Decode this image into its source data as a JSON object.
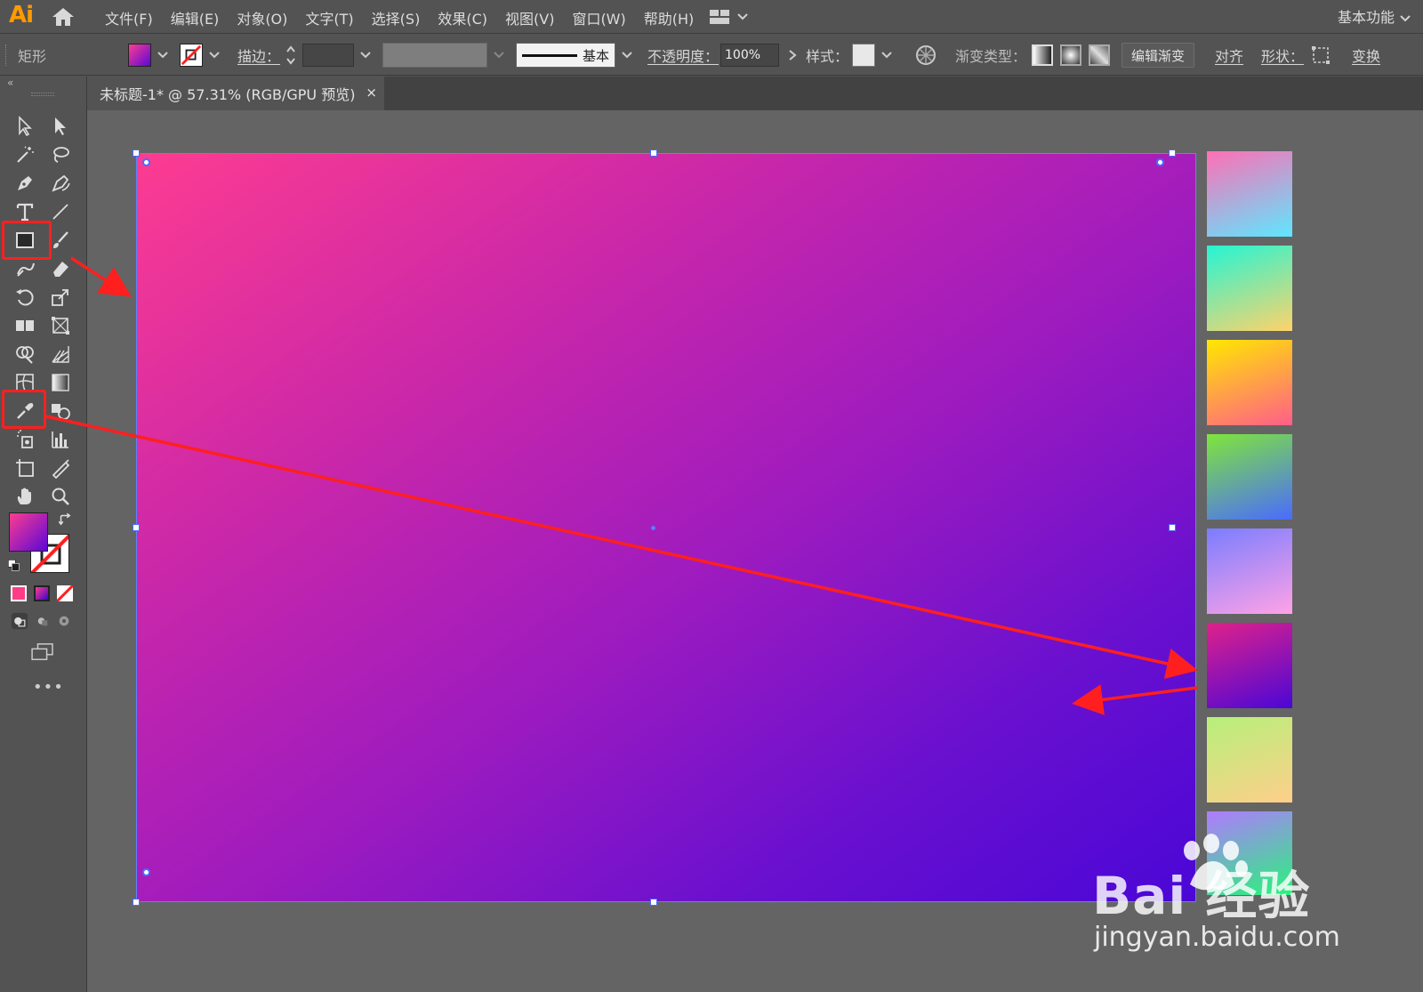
{
  "app": {
    "logo": "Ai",
    "workspace": "基本功能"
  },
  "menu": [
    "文件(F)",
    "编辑(E)",
    "对象(O)",
    "文字(T)",
    "选择(S)",
    "效果(C)",
    "视图(V)",
    "窗口(W)",
    "帮助(H)"
  ],
  "control": {
    "object_type": "矩形",
    "stroke_label": "描边：",
    "stroke_profile": "基本",
    "opacity_label": "不透明度：",
    "opacity_value": "100%",
    "style_label": "样式：",
    "gradient_type_label": "渐变类型：",
    "edit_gradient": "编辑渐变",
    "align": "对齐",
    "shape_label": "形状：",
    "transform": "变换"
  },
  "document": {
    "tab_title": "未标题-1* @ 57.31% (RGB/GPU 预览)",
    "close": "×"
  },
  "colors": {
    "fill_gradient": [
      "#fd3c91",
      "#4a07d6"
    ],
    "highlight": "#ff2020",
    "selection": "#4b6cff"
  },
  "swatches": [
    {
      "name": "pink-cyan",
      "from": "#ff6fb5",
      "to": "#5ee7ff"
    },
    {
      "name": "aqua-yellow",
      "from": "#25f5d4",
      "to": "#ffd36a"
    },
    {
      "name": "yellow-pink",
      "from": "#ffe800",
      "to": "#ff5e8a"
    },
    {
      "name": "green-blue",
      "from": "#7fe63a",
      "to": "#4a6bff"
    },
    {
      "name": "blue-cyan-pink",
      "from": "#7a7dff",
      "to": "#ffa2e6"
    },
    {
      "name": "magenta-violet",
      "from": "#e0218a",
      "to": "#4a07d6"
    },
    {
      "name": "mint-peach",
      "from": "#b6f07a",
      "to": "#ffcf8a"
    },
    {
      "name": "violet-green",
      "from": "#b07aff",
      "to": "#27f57a"
    }
  ],
  "watermark": {
    "brand": "Bai 经验",
    "url": "jingyan.baidu.com"
  }
}
